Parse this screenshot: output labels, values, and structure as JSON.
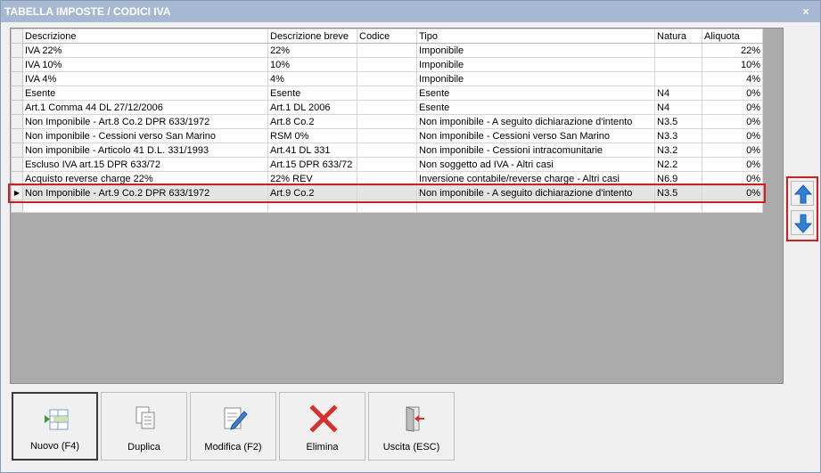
{
  "window": {
    "title": "TABELLA IMPOSTE / CODICI IVA",
    "close_glyph": "×"
  },
  "grid": {
    "columns": [
      "Descrizione",
      "Descrizione breve",
      "Codice",
      "Tipo",
      "Natura",
      "Aliquota"
    ],
    "rows": [
      {
        "descrizione": "IVA 22%",
        "breve": "22%",
        "codice": "",
        "tipo": "Imponibile",
        "natura": "",
        "aliquota": "22%"
      },
      {
        "descrizione": "IVA 10%",
        "breve": "10%",
        "codice": "",
        "tipo": "Imponibile",
        "natura": "",
        "aliquota": "10%"
      },
      {
        "descrizione": "IVA 4%",
        "breve": "4%",
        "codice": "",
        "tipo": "Imponibile",
        "natura": "",
        "aliquota": "4%"
      },
      {
        "descrizione": "Esente",
        "breve": "Esente",
        "codice": "",
        "tipo": "Esente",
        "natura": "N4",
        "aliquota": "0%"
      },
      {
        "descrizione": "Art.1 Comma 44 DL 27/12/2006",
        "breve": "Art.1 DL 2006",
        "codice": "",
        "tipo": "Esente",
        "natura": "N4",
        "aliquota": "0%"
      },
      {
        "descrizione": "Non Imponibile - Art.8 Co.2 DPR 633/1972",
        "breve": "Art.8 Co.2",
        "codice": "",
        "tipo": "Non imponibile - A seguito dichiarazione d'intento",
        "natura": "N3.5",
        "aliquota": "0%"
      },
      {
        "descrizione": "Non imponibile - Cessioni verso San Marino",
        "breve": "RSM 0%",
        "codice": "",
        "tipo": "Non imponibile - Cessioni verso San Marino",
        "natura": "N3.3",
        "aliquota": "0%"
      },
      {
        "descrizione": "Non imponibile - Articolo 41 D.L. 331/1993",
        "breve": "Art.41 DL 331",
        "codice": "",
        "tipo": "Non imponibile - Cessioni intracomunitarie",
        "natura": "N3.2",
        "aliquota": "0%"
      },
      {
        "descrizione": "Escluso IVA art.15 DPR 633/72",
        "breve": "Art.15 DPR 633/72",
        "codice": "",
        "tipo": "Non soggetto ad IVA - Altri casi",
        "natura": "N2.2",
        "aliquota": "0%"
      },
      {
        "descrizione": "Acquisto reverse charge 22%",
        "breve": "22% REV",
        "codice": "",
        "tipo": "Inversione contabile/reverse charge - Altri casi",
        "natura": "N6.9",
        "aliquota": "0%"
      },
      {
        "descrizione": "Non Imponibile - Art.9 Co.2 DPR 633/1972",
        "breve": "Art.9 Co.2",
        "codice": "",
        "tipo": "Non imponibile - A seguito dichiarazione d'intento",
        "natura": "N3.5",
        "aliquota": "0%"
      }
    ],
    "selected_row_marker": "▶"
  },
  "reorder": {
    "up_icon": "arrow-up-icon",
    "down_icon": "arrow-down-icon",
    "accent": "#2f7ed8"
  },
  "toolbar": {
    "nuovo": "Nuovo (F4)",
    "duplica": "Duplica",
    "modifica": "Modifica (F2)",
    "elimina": "Elimina",
    "uscita": "Uscita (ESC)"
  },
  "colors": {
    "highlight_border": "#cc1f1f",
    "title_bar": "#a7b9d2",
    "delete_red": "#d9302c"
  }
}
